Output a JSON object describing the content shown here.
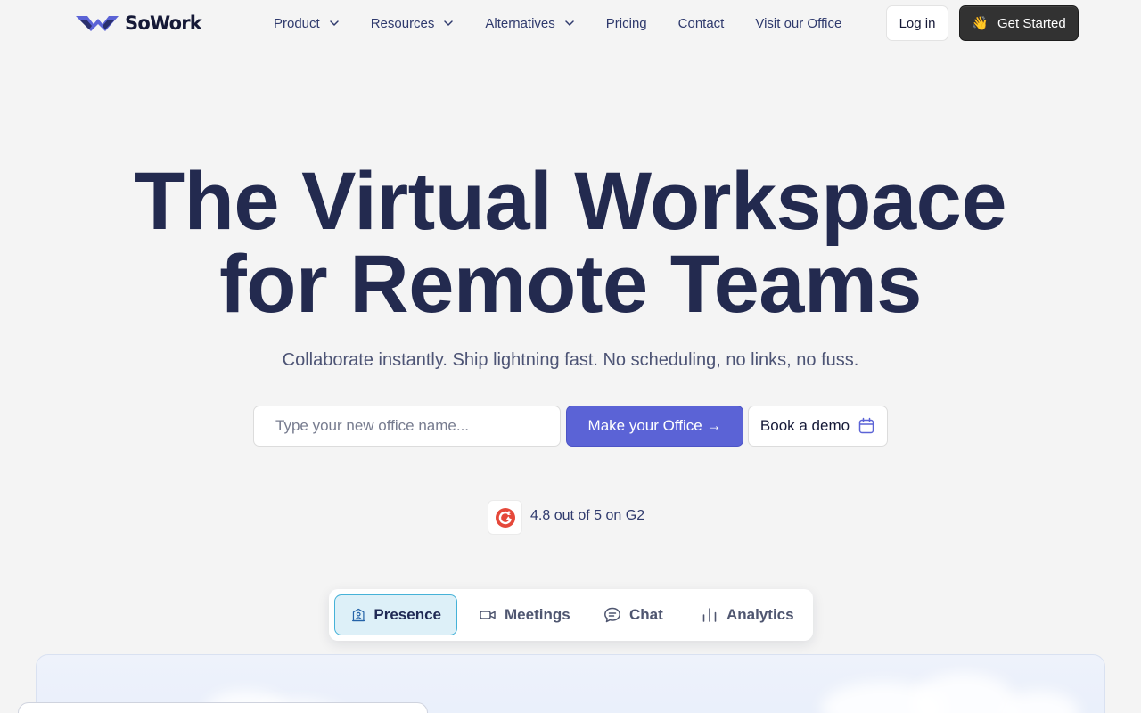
{
  "brand": {
    "name": "SoWork"
  },
  "nav": {
    "items": [
      {
        "label": "Product",
        "dropdown": true
      },
      {
        "label": "Resources",
        "dropdown": true
      },
      {
        "label": "Alternatives",
        "dropdown": true
      },
      {
        "label": "Pricing",
        "dropdown": false
      },
      {
        "label": "Contact",
        "dropdown": false
      },
      {
        "label": "Visit our Office",
        "dropdown": false
      }
    ],
    "login_label": "Log in",
    "cta_icon": "👋",
    "cta_label": "Get Started"
  },
  "hero": {
    "title_line1": "The Virtual Workspace",
    "title_line2": "for Remote Teams",
    "subtitle": "Collaborate instantly. Ship lightning fast. No scheduling, no links, no fuss.",
    "input_placeholder": "Type your new office name...",
    "input_value": "",
    "primary_button": "Make your Office →",
    "demo_button": "Book a demo"
  },
  "rating": {
    "text": "4.8 out of 5 on G2"
  },
  "feature_tabs": [
    {
      "label": "Presence",
      "icon": "office-building-icon",
      "active": true
    },
    {
      "label": "Meetings",
      "icon": "video-camera-icon",
      "active": false
    },
    {
      "label": "Chat",
      "icon": "chat-bubble-icon",
      "active": false
    },
    {
      "label": "Analytics",
      "icon": "bar-chart-icon",
      "active": false
    }
  ],
  "colors": {
    "background": "#f4f4f4",
    "heading": "#232a4f",
    "accent": "#5b63d6",
    "tab_active_bg": "#ddf0f8",
    "tab_active_border": "#45b2d8",
    "g2_red": "#e5483a"
  }
}
